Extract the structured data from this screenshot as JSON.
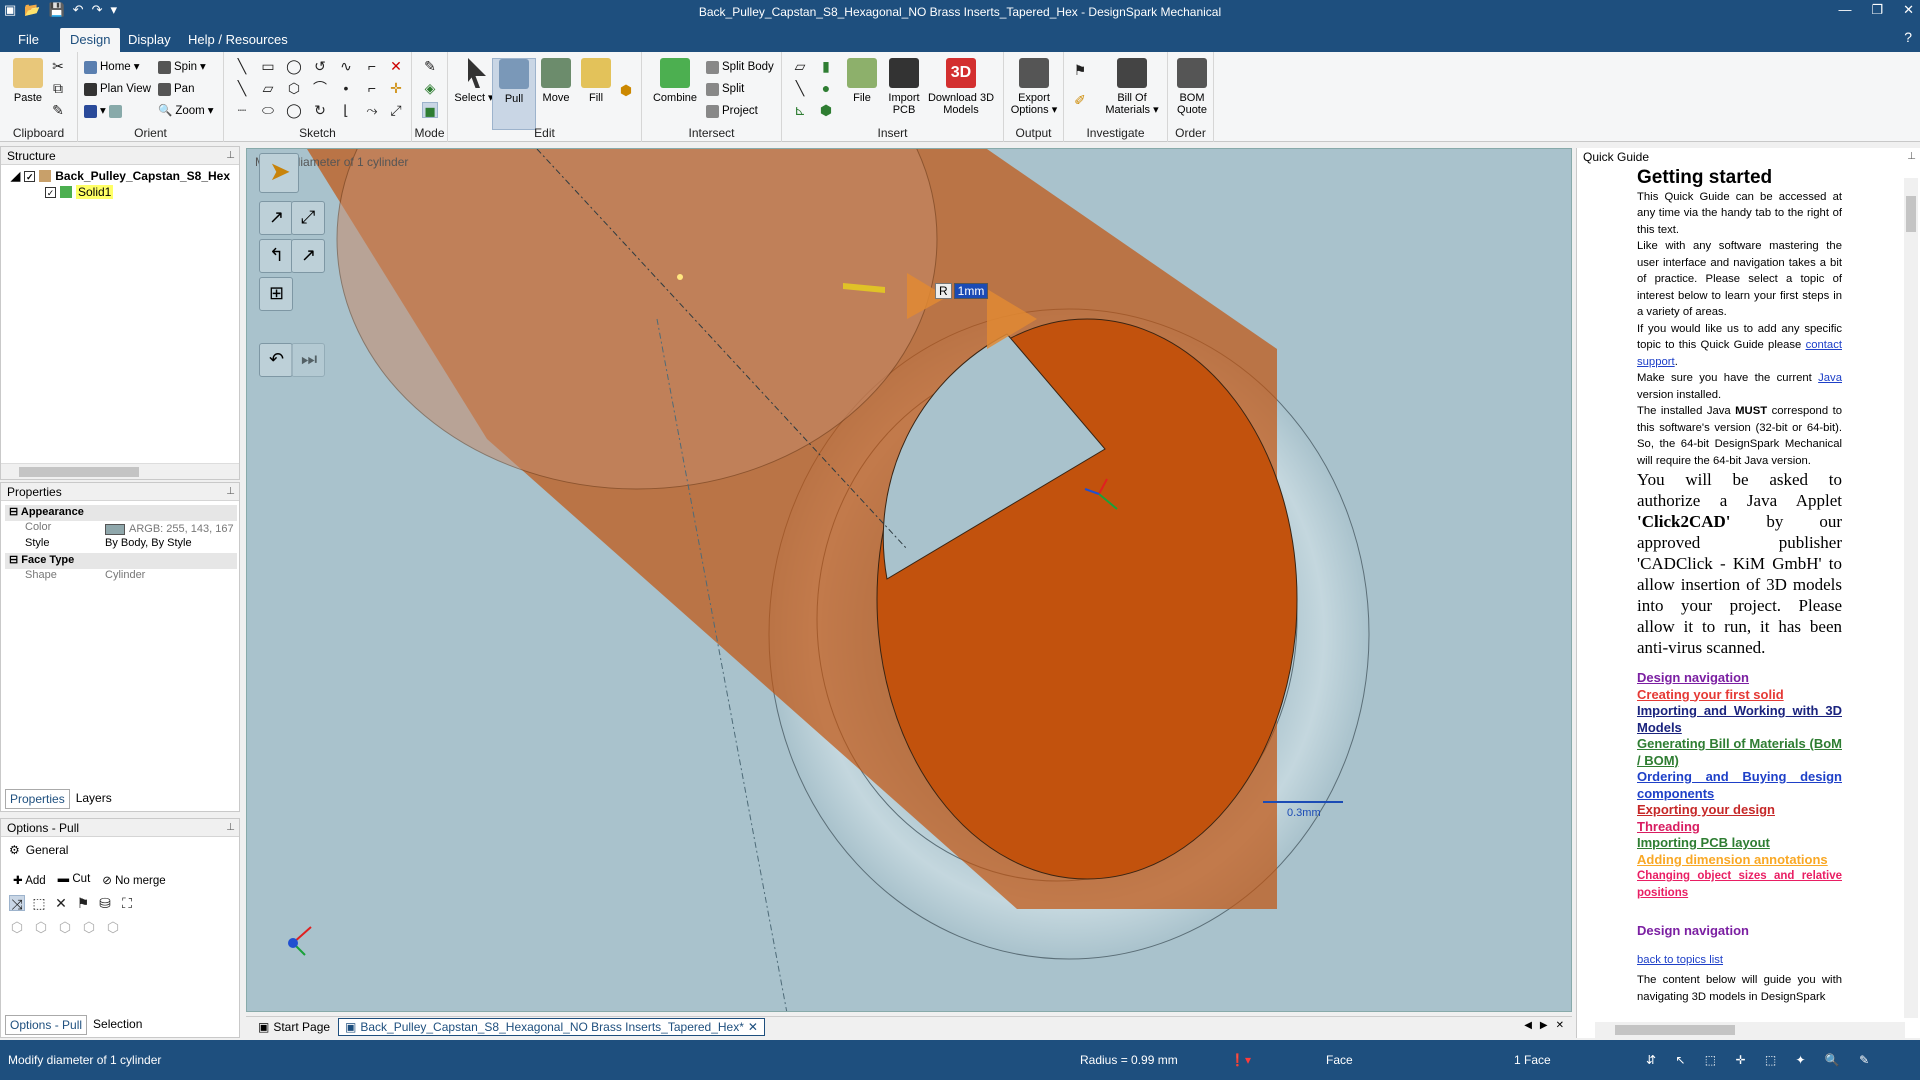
{
  "window": {
    "title": "Back_Pulley_Capstan_S8_Hexagonal_NO Brass Inserts_Tapered_Hex - DesignSpark Mechanical"
  },
  "menu_tabs": [
    "File",
    "Design",
    "Display",
    "Help / Resources"
  ],
  "ribbon": {
    "clipboard": {
      "label": "Clipboard",
      "paste": "Paste"
    },
    "orient": {
      "label": "Orient",
      "home": "Home",
      "spin": "Spin",
      "plan_view": "Plan View",
      "pan": "Pan",
      "zoom": "Zoom"
    },
    "sketch": {
      "label": "Sketch"
    },
    "mode": {
      "label": "Mode"
    },
    "edit": {
      "label": "Edit",
      "select": "Select",
      "pull": "Pull",
      "move": "Move",
      "fill": "Fill"
    },
    "intersect": {
      "label": "Intersect",
      "combine": "Combine",
      "split_body": "Split Body",
      "split": "Split",
      "project": "Project"
    },
    "insert": {
      "label": "Insert",
      "file": "File",
      "import_pcb": "Import PCB",
      "download_3d": "Download 3D Models"
    },
    "output": {
      "label": "Output",
      "export": "Export Options"
    },
    "investigate": {
      "label": "Investigate",
      "bom": "Bill Of Materials"
    },
    "order": {
      "label": "Order",
      "bom_quote": "BOM Quote"
    }
  },
  "structure": {
    "title": "Structure",
    "root": "Back_Pulley_Capstan_S8_Hex",
    "child": "Solid1"
  },
  "properties": {
    "title": "Properties",
    "appearance": "Appearance",
    "color_label": "Color",
    "color_value": "ARGB: 255, 143, 167",
    "style_label": "Style",
    "style_value": "By Body, By Style",
    "face_type": "Face Type",
    "shape_label": "Shape",
    "shape_value": "Cylinder",
    "tabs": [
      "Properties",
      "Layers"
    ]
  },
  "options": {
    "title": "Options - Pull",
    "general": "General",
    "add": "Add",
    "cut": "Cut",
    "no_merge": "No merge",
    "bottom_tabs": [
      "Options - Pull",
      "Selection"
    ]
  },
  "viewport": {
    "hint": "Modify diameter of 1 cylinder",
    "dim_prefix": "R",
    "dim_value": "1mm",
    "scale": "0.3mm",
    "colors": {
      "bg": "#a9c2cc",
      "solid": "#c2520d",
      "ring": "#b6cbd3"
    }
  },
  "doc_tabs": [
    "Start Page",
    "Back_Pulley_Capstan_S8_Hexagonal_NO Brass Inserts_Tapered_Hex*"
  ],
  "quick_guide": {
    "title": "Quick Guide",
    "heading": "Getting started",
    "p1": "This Quick Guide can be accessed at any time via the handy tab to the right of this text.",
    "p2": "Like with any software mastering the user interface and navigation takes a bit of practice. Please select a topic of interest below to learn your first steps in a variety of areas.",
    "p3a": "If you would like us to add any specific topic to this Quick Guide please ",
    "p3link": "contact support",
    "p4a": "Make sure you have the current ",
    "p4link": "Java",
    "p4b": " version installed.",
    "p5a": "The installed Java ",
    "p5b": "MUST",
    "p5c": " correspond to this software's version (32-bit or 64-bit). So, the 64-bit DesignSpark Mechanical will require the 64-bit Java version.",
    "p6a": "You will be asked to authorize a Java Applet ",
    "p6b": "'Click2CAD'",
    "p6c": " by our approved publisher 'CADClick - KiM GmbH' to allow insertion of 3D models into your project. Please allow it to run, it has been anti-virus scanned.",
    "links": [
      {
        "text": "Design navigation",
        "color": "#7b1fa2"
      },
      {
        "text": "Creating your first solid",
        "color": "#e53935"
      },
      {
        "text": "Importing and Working with 3D Models",
        "color": "#1a237e"
      },
      {
        "text": "Generating Bill of Materials (BoM / BOM)",
        "color": "#2e7d32"
      },
      {
        "text": "Ordering and Buying design components",
        "color": "#1e40c8"
      },
      {
        "text": "Exporting your design",
        "color": "#c62828"
      },
      {
        "text": "Threading",
        "color": "#d81b60"
      },
      {
        "text": "Importing PCB layout",
        "color": "#2e7d32"
      },
      {
        "text": "Adding dimension annotations",
        "color": "#f9a825"
      },
      {
        "text": "Changing object sizes and relative positions",
        "color": "#e91e63"
      }
    ],
    "section_heading": "Design navigation",
    "back_link": "back to topics list",
    "p7": "The content below will guide you with navigating 3D models in DesignSpark"
  },
  "status": {
    "left": "Modify diameter of 1 cylinder",
    "radius": "Radius = 0.99 mm",
    "face": "Face",
    "count": "1 Face"
  }
}
